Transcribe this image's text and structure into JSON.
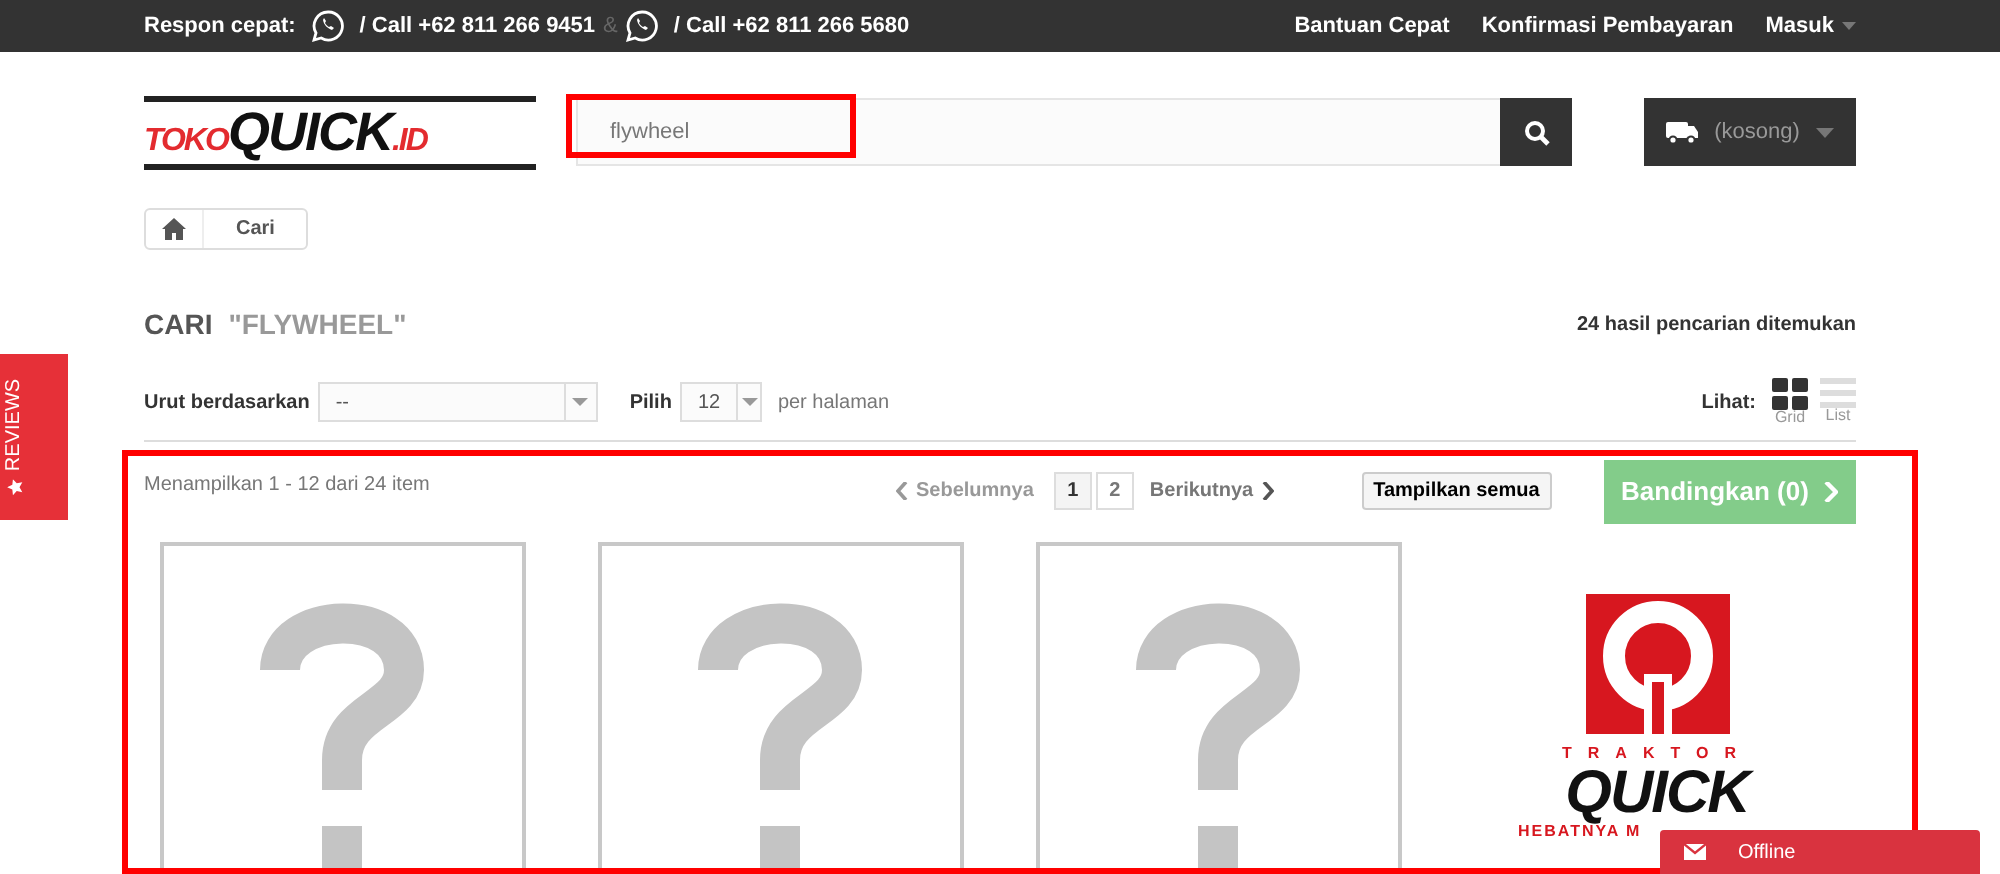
{
  "top_bar": {
    "label": "Respon cepat:",
    "contacts": [
      {
        "text": "/ Call +62 811 266 9451"
      },
      {
        "text": "/ Call +62 811 266 5680"
      }
    ],
    "separator": "&",
    "links": [
      {
        "label": "Bantuan Cepat",
        "dropdown": false
      },
      {
        "label": "Konfirmasi Pembayaran",
        "dropdown": false
      },
      {
        "label": "Masuk",
        "dropdown": true
      }
    ]
  },
  "header": {
    "logo": {
      "parts": [
        "TOKO",
        "QUICK",
        ".ID"
      ]
    },
    "search": {
      "value": "flywheel"
    },
    "cart": {
      "label": "(kosong)"
    }
  },
  "breadcrumb": [
    "Cari"
  ],
  "heading": {
    "title": "CARI",
    "query": "\"FLYWHEEL\"",
    "count": "24 hasil pencarian ditemukan"
  },
  "sort": {
    "label": "Urut berdasarkan",
    "value": "--"
  },
  "per_page": {
    "label": "Pilih",
    "value": "12",
    "suffix": "per halaman"
  },
  "view": {
    "label": "Lihat:",
    "options": [
      {
        "label": "Grid",
        "selected": true
      },
      {
        "label": "List",
        "selected": false
      }
    ]
  },
  "results": {
    "summary": "Menampilkan 1 - 12 dari 24 item",
    "prev": "Sebelumnya",
    "pages": [
      {
        "label": "1",
        "selected": true
      },
      {
        "label": "2",
        "selected": false
      }
    ],
    "next": "Berikutnya",
    "show_all": "Tampilkan semua",
    "compare": "Bandingkan (0)"
  },
  "products": [
    {
      "kind": "placeholder"
    },
    {
      "kind": "placeholder"
    },
    {
      "kind": "placeholder"
    },
    {
      "kind": "logo",
      "texts": [
        "TRAKTOR",
        "QUICK",
        "HEBATNYA M"
      ]
    }
  ],
  "side_tab": {
    "label": "REVIEWS"
  },
  "chat": {
    "label": "Offline"
  }
}
